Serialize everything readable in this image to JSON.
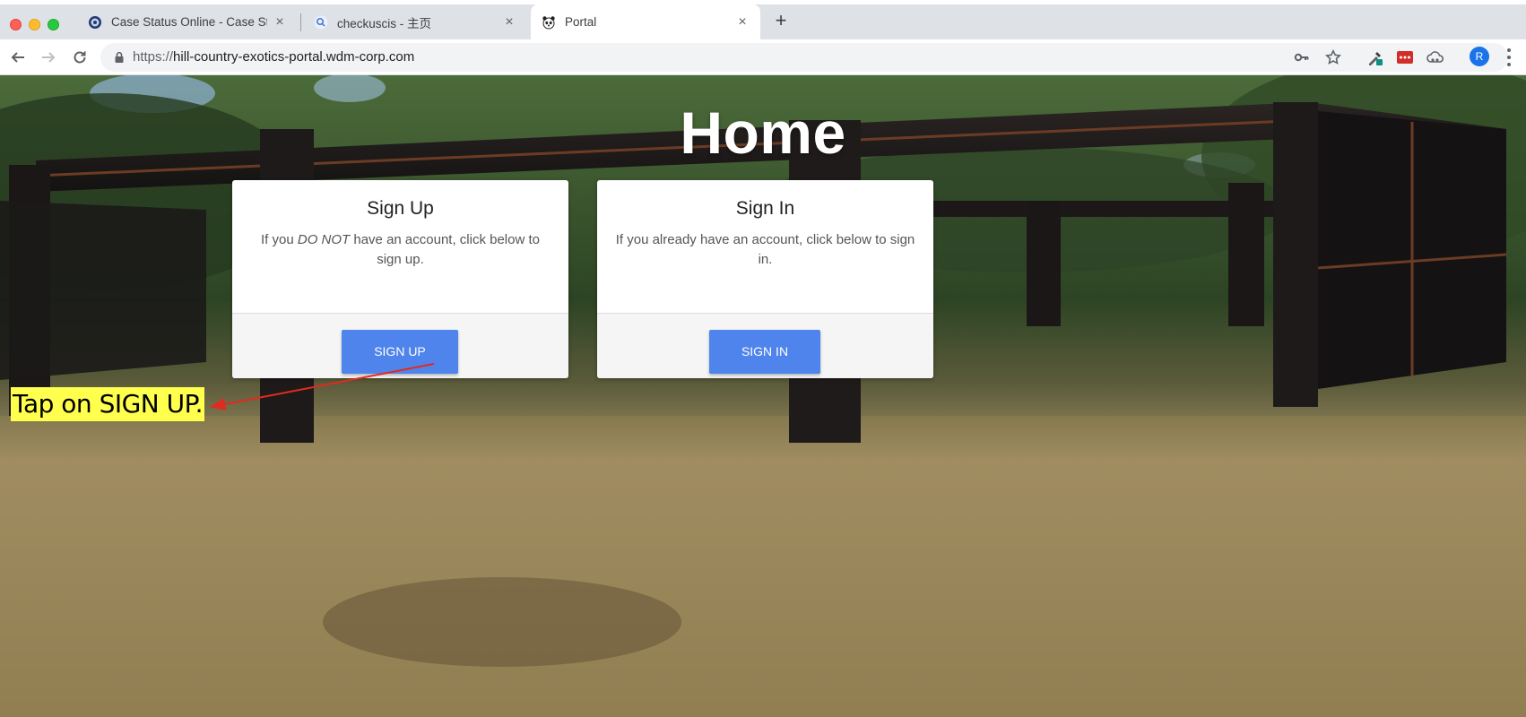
{
  "browser": {
    "tabs": [
      {
        "title": "Case Status Online - Case Stat",
        "icon": "uscis-seal-icon",
        "active": false
      },
      {
        "title": "checkuscis - 主页",
        "icon": "search-icon",
        "active": false
      },
      {
        "title": "Portal",
        "icon": "panda-icon",
        "active": true
      }
    ],
    "new_tab_label": "+",
    "url": {
      "scheme": "https://",
      "host": "hill-country-exotics-portal.wdm-corp.com"
    },
    "profile_initial": "R",
    "extensions": [
      "key-icon",
      "star-icon",
      "eyedropper-icon",
      "lastpass-icon",
      "cloud-icon"
    ]
  },
  "page": {
    "title": "Home",
    "signup_card": {
      "heading": "Sign Up",
      "desc_prefix": "If you ",
      "desc_emphasis": "DO NOT",
      "desc_suffix": " have an account, click below to sign up.",
      "button": "SIGN UP"
    },
    "signin_card": {
      "heading": "Sign In",
      "desc": "If you already have an account, click below to sign in.",
      "button": "SIGN IN"
    }
  },
  "annotation": {
    "text": "Tap on SIGN UP.",
    "color": "#ffff4d",
    "arrow_color": "#e02b20"
  },
  "colors": {
    "button": "#4f84ec",
    "tab_bar": "#dee1e6"
  }
}
